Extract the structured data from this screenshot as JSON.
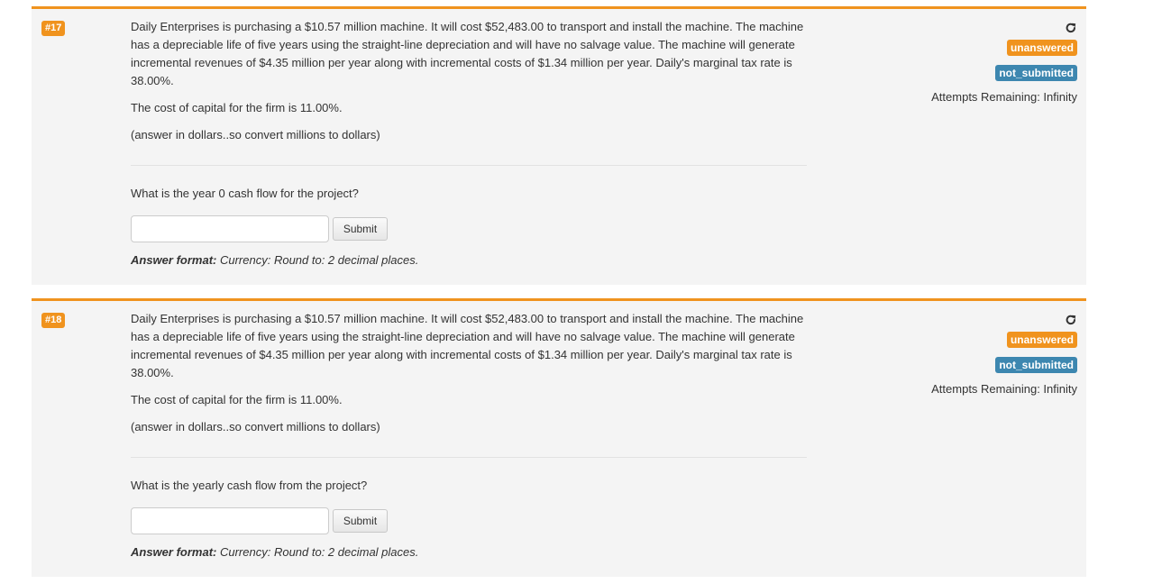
{
  "questions": [
    {
      "number": "#17",
      "paragraphs": {
        "intro": "Daily Enterprises is purchasing a $10.57 million machine. It will cost $52,483.00 to transport and install the machine. The machine has a depreciable life of five years using the straight-line depreciation and will have no salvage value. The machine will generate incremental revenues of $4.35 million per year along with incremental costs of $1.34 million per year. Daily's marginal tax rate is 38.00%.",
        "cost_of_capital": "The cost of capital for the firm is 11.00%.",
        "note": "(answer in dollars..so convert millions to dollars)"
      },
      "prompt": "What is the year 0 cash flow for the project?",
      "input_value": "",
      "submit_label": "Submit",
      "answer_format_label": "Answer format:",
      "answer_format_text": "Currency: Round to: 2 decimal places.",
      "status_badge": "unanswered",
      "submission_badge": "not_submitted",
      "attempts": "Attempts Remaining: Infinity"
    },
    {
      "number": "#18",
      "paragraphs": {
        "intro": "Daily Enterprises is purchasing a $10.57 million machine. It will cost $52,483.00 to transport and install the machine. The machine has a depreciable life of five years using the straight-line depreciation and will have no salvage value. The machine will generate incremental revenues of $4.35 million per year along with incremental costs of $1.34 million per year. Daily's marginal tax rate is 38.00%.",
        "cost_of_capital": "The cost of capital for the firm is 11.00%.",
        "note": "(answer in dollars..so convert millions to dollars)"
      },
      "prompt": "What is the yearly cash flow from the project?",
      "input_value": "",
      "submit_label": "Submit",
      "answer_format_label": "Answer format:",
      "answer_format_text": "Currency: Round to: 2 decimal places.",
      "status_badge": "unanswered",
      "submission_badge": "not_submitted",
      "attempts": "Attempts Remaining: Infinity"
    }
  ],
  "colors": {
    "accent_orange": "#f0931e",
    "badge_blue": "#3d87b0",
    "panel_bg": "#f4f4f4"
  },
  "icons": {
    "reset": "redo-icon"
  }
}
